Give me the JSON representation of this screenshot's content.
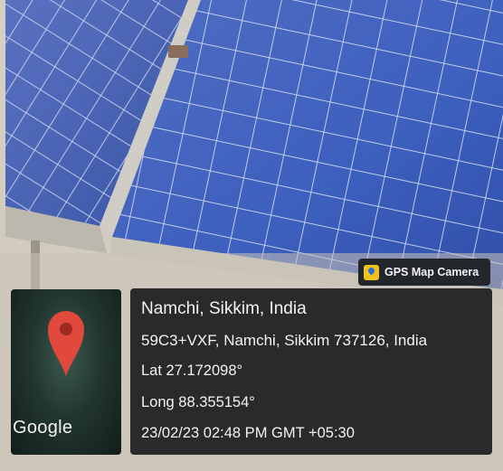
{
  "badge": {
    "icon": "gps-map-camera-app-icon",
    "label": "GPS Map Camera"
  },
  "map": {
    "icon": "location-pin-icon",
    "brand": "Google"
  },
  "info": {
    "place": "Namchi, Sikkim, India",
    "address": "59C3+VXF, Namchi, Sikkim 737126, India",
    "lat": "Lat 27.172098°",
    "long": "Long 88.355154°",
    "datetime": "23/02/23 02:48 PM GMT +05:30"
  },
  "colors": {
    "panel_blue": "#3f5db0",
    "pin_red": "#e0493b",
    "overlay_dark": "#2a2a2c"
  }
}
